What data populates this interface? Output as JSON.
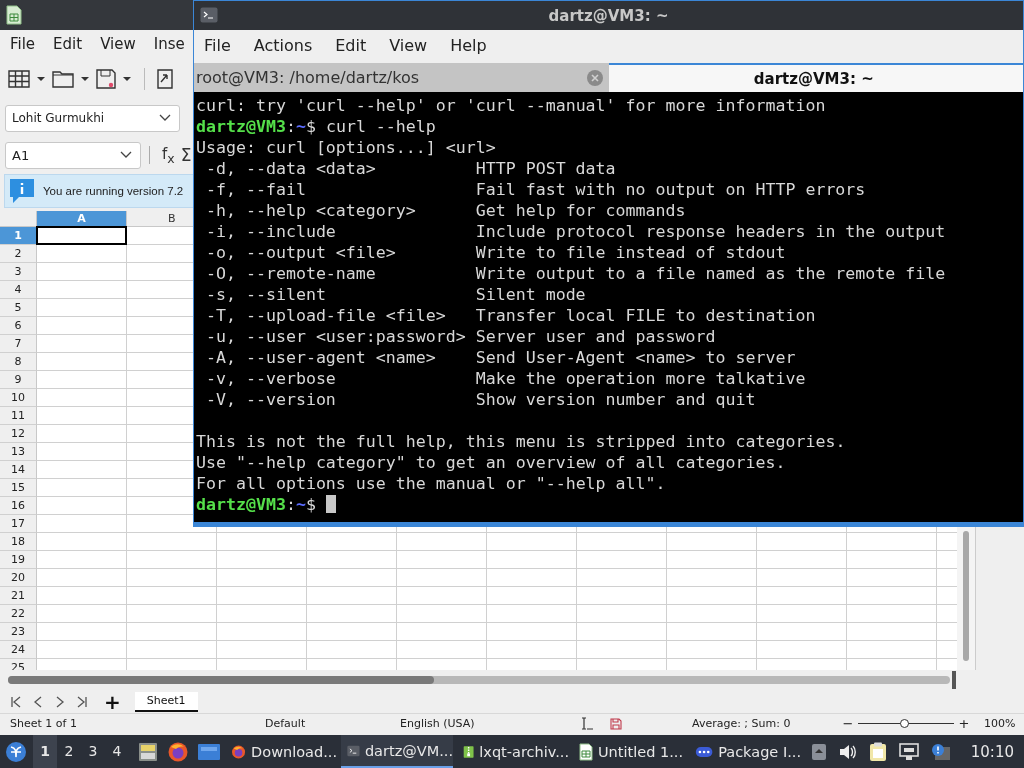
{
  "spreadsheet": {
    "menu": [
      "File",
      "Edit",
      "View",
      "Inse"
    ],
    "font_name": "Lohit Gurmukhi",
    "cell_reference": "A1",
    "function_label": "f$_{x}$",
    "sum_label": "Σ",
    "info_message": "You are running version 7.2",
    "columns": [
      {
        "label": "A",
        "selected": true
      },
      {
        "label": "B",
        "selected": false
      }
    ],
    "rows": [
      {
        "label": "1",
        "selected": true
      },
      {
        "label": "2",
        "selected": false
      },
      {
        "label": "3",
        "selected": false
      },
      {
        "label": "4",
        "selected": false
      },
      {
        "label": "5",
        "selected": false
      },
      {
        "label": "6",
        "selected": false
      },
      {
        "label": "7",
        "selected": false
      },
      {
        "label": "8",
        "selected": false
      },
      {
        "label": "9",
        "selected": false
      },
      {
        "label": "10",
        "selected": false
      },
      {
        "label": "11",
        "selected": false
      },
      {
        "label": "12",
        "selected": false
      },
      {
        "label": "13",
        "selected": false
      },
      {
        "label": "14",
        "selected": false
      },
      {
        "label": "15",
        "selected": false
      },
      {
        "label": "16",
        "selected": false
      },
      {
        "label": "17",
        "selected": false
      },
      {
        "label": "18",
        "selected": false
      },
      {
        "label": "19",
        "selected": false
      },
      {
        "label": "20",
        "selected": false
      },
      {
        "label": "21",
        "selected": false
      },
      {
        "label": "22",
        "selected": false
      },
      {
        "label": "23",
        "selected": false
      },
      {
        "label": "24",
        "selected": false
      },
      {
        "label": "25",
        "selected": false
      }
    ],
    "add_sheet": "+",
    "sheet_tabs": [
      {
        "label": "Sheet1",
        "selected": true
      }
    ],
    "status": {
      "sheet": "Sheet 1 of 1",
      "page_style": "Default",
      "language": "English (USA)",
      "selection_summary": "Average: ; Sum: 0",
      "zoom_out": "−",
      "zoom_in": "+",
      "zoom": {
        "level": 0.48
      },
      "zoom_percent": "100%"
    }
  },
  "terminal": {
    "title": "dartz@VM3: ~",
    "menu": [
      "File",
      "Actions",
      "Edit",
      "View",
      "Help"
    ],
    "tabs": [
      {
        "label": "root@VM3: /home/dartz/kos",
        "selected": false
      },
      {
        "label": "dartz@VM3: ~",
        "selected": true
      }
    ],
    "lines": [
      {
        "kind": "text",
        "text": "curl: try 'curl --help' or 'curl --manual' for more information"
      },
      {
        "kind": "prompt",
        "user": "dartz@VM3",
        "sep": ":",
        "path": "~",
        "symbol": "$",
        "command": "curl --help",
        "cursor": false
      },
      {
        "kind": "text",
        "text": "Usage: curl [options...] <url>"
      },
      {
        "kind": "option",
        "flag": "-d, --data <data>",
        "desc": "HTTP POST data"
      },
      {
        "kind": "option",
        "flag": "-f, --fail",
        "desc": "Fail fast with no output on HTTP errors"
      },
      {
        "kind": "option",
        "flag": "-h, --help <category>",
        "desc": "Get help for commands"
      },
      {
        "kind": "option",
        "flag": "-i, --include",
        "desc": "Include protocol response headers in the output"
      },
      {
        "kind": "option",
        "flag": "-o, --output <file>",
        "desc": "Write to file instead of stdout"
      },
      {
        "kind": "option",
        "flag": "-O, --remote-name",
        "desc": "Write output to a file named as the remote file"
      },
      {
        "kind": "option",
        "flag": "-s, --silent",
        "desc": "Silent mode"
      },
      {
        "kind": "option",
        "flag": "-T, --upload-file <file>",
        "desc": "Transfer local FILE to destination"
      },
      {
        "kind": "option",
        "flag": "-u, --user <user:password>",
        "desc": "Server user and password"
      },
      {
        "kind": "option",
        "flag": "-A, --user-agent <name>",
        "desc": "Send User-Agent <name> to server"
      },
      {
        "kind": "option",
        "flag": "-v, --verbose",
        "desc": "Make the operation more talkative"
      },
      {
        "kind": "option",
        "flag": "-V, --version",
        "desc": "Show version number and quit"
      },
      {
        "kind": "blank"
      },
      {
        "kind": "text",
        "text": "This is not the full help, this menu is stripped into categories."
      },
      {
        "kind": "text",
        "text": "Use \"--help category\" to get an overview of all categories."
      },
      {
        "kind": "text",
        "text": "For all options use the manual or \"--help all\"."
      },
      {
        "kind": "prompt",
        "user": "dartz@VM3",
        "sep": ":",
        "path": "~",
        "symbol": "$",
        "cursor": true
      }
    ]
  },
  "taskbar": {
    "desktops": [
      {
        "label": "1",
        "selected": true
      },
      {
        "label": "2",
        "selected": false
      },
      {
        "label": "3",
        "selected": false
      },
      {
        "label": "4",
        "selected": false
      }
    ],
    "windows": [
      {
        "kind": "browser",
        "label": "Download...",
        "selected": false
      },
      {
        "kind": "terminal",
        "label": "dartz@VM...",
        "selected": true
      },
      {
        "kind": "archive",
        "label": "lxqt-archiv...",
        "selected": false
      },
      {
        "kind": "spreadsheet",
        "label": "Untitled 1...",
        "selected": false
      },
      {
        "kind": "packages",
        "label": "Package I...",
        "selected": false
      }
    ],
    "clock": "10:10"
  }
}
